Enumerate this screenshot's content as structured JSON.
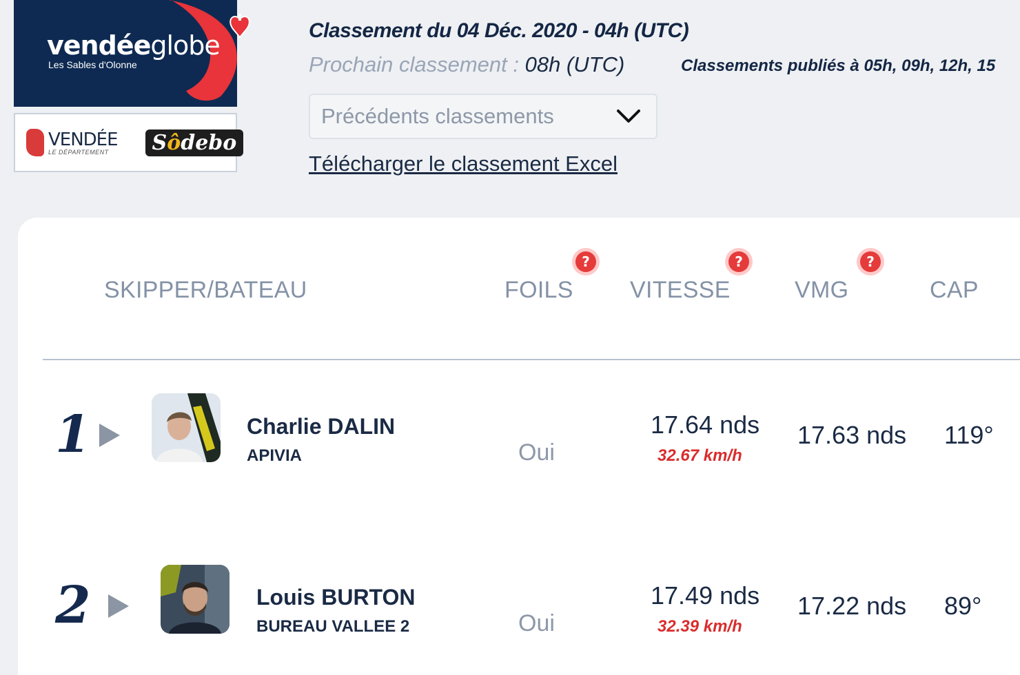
{
  "brand": {
    "logo_word_bold": "vendée",
    "logo_word_light": "globe",
    "logo_sub": "Les Sables d'Olonne",
    "accent": "#e8343a",
    "navy": "#0e2a52"
  },
  "sponsors": {
    "vendee_title": "VENDÉE",
    "vendee_sub": "LE DÉPARTEMENT",
    "sodebo_pre": "S",
    "sodebo_sun": "ô",
    "sodebo_post": "debo"
  },
  "ranking": {
    "title": "Classement du 04 Déc. 2020 - 04h (UTC)",
    "next_label": "Prochain classement : ",
    "next_time": "08h (UTC)",
    "published": "Classements publiés à 05h, 09h, 12h, 15",
    "previous_select": "Précédents classements",
    "excel_link": "Télécharger le classement Excel"
  },
  "table": {
    "headers": {
      "skipper": "SKIPPER/BATEAU",
      "foils": "FOILS",
      "speed": "VITESSE",
      "vmg": "VMG",
      "cap": "CAP"
    },
    "help_glyph": "?",
    "rows": [
      {
        "rank": "1",
        "skipper": "Charlie DALIN",
        "boat": "APIVIA",
        "foils": "Oui",
        "speed": "17.64 nds",
        "speed_kmh": "32.67 km/h",
        "vmg": "17.63 nds",
        "cap": "119°"
      },
      {
        "rank": "2",
        "skipper": "Louis BURTON",
        "boat": "BUREAU VALLEE 2",
        "foils": "Oui",
        "speed": "17.49 nds",
        "speed_kmh": "32.39 km/h",
        "vmg": "17.22 nds",
        "cap": "89°"
      }
    ]
  }
}
